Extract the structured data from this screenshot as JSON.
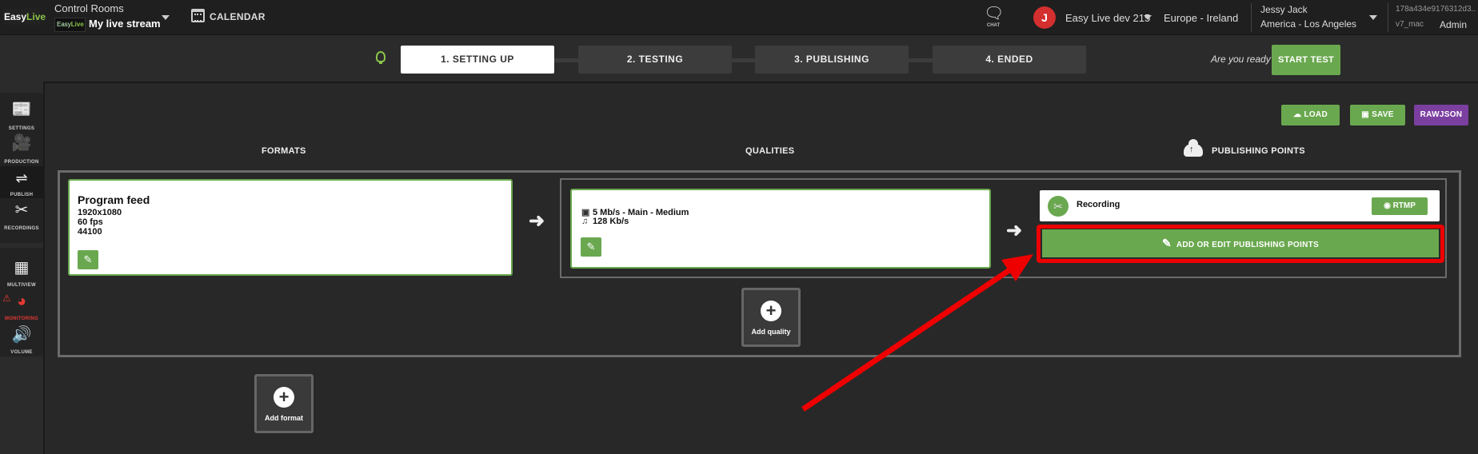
{
  "topbar": {
    "logo": {
      "part1": "Easy",
      "part2": "Live"
    },
    "control_rooms_label": "Control Rooms",
    "thumb": {
      "part1": "Easy",
      "part2": "Live"
    },
    "stream_name": "My live stream",
    "calendar_label": "CALENDAR",
    "chat_label": "CHAT",
    "avatar_initial": "J",
    "org": "Easy Live dev 215",
    "region": "Europe - Ireland",
    "user_name": "Jessy Jack",
    "timezone": "America - Los Angeles",
    "build_id": "178a434e9176312d3...",
    "version": "v7_mac",
    "role": "Admin"
  },
  "steps": {
    "items": [
      {
        "label": "1.  SETTING UP",
        "active": true
      },
      {
        "label": "2. TESTING",
        "active": false
      },
      {
        "label": "3. PUBLISHING",
        "active": false
      },
      {
        "label": "4.  ENDED",
        "active": false
      }
    ],
    "ready_text": "Are you ready?",
    "start_test": "START TEST"
  },
  "sidebar": {
    "settings": "SETTINGS",
    "production": "PRODUCTION",
    "publish": "PUBLISH",
    "recordings": "RECORDINGS",
    "multiview": "MULTIVIEW",
    "monitoring": "MONITORING",
    "volume": "VOLUME"
  },
  "actions": {
    "load": "LOAD",
    "save": "SAVE",
    "rawjson": "RAWJSON"
  },
  "columns": {
    "formats": "FORMATS",
    "qualities": "QUALITIES",
    "publishing_points": "PUBLISHING POINTS"
  },
  "format": {
    "title": "Program feed",
    "resolution": "1920x1080",
    "fps": "60 fps",
    "audio": "44100"
  },
  "quality": {
    "video": "5 Mb/s  -  Main  -  Medium",
    "audio": "128 Kb/s"
  },
  "publishing_point": {
    "name": "Recording",
    "protocol": "RTMP"
  },
  "add_edit_label": "ADD OR EDIT PUBLISHING POINTS",
  "add_quality": "Add quality",
  "add_format": "Add format",
  "colors": {
    "accent": "#6aa84f",
    "highlight": "#ee0000",
    "purple": "#7b3fa0"
  }
}
